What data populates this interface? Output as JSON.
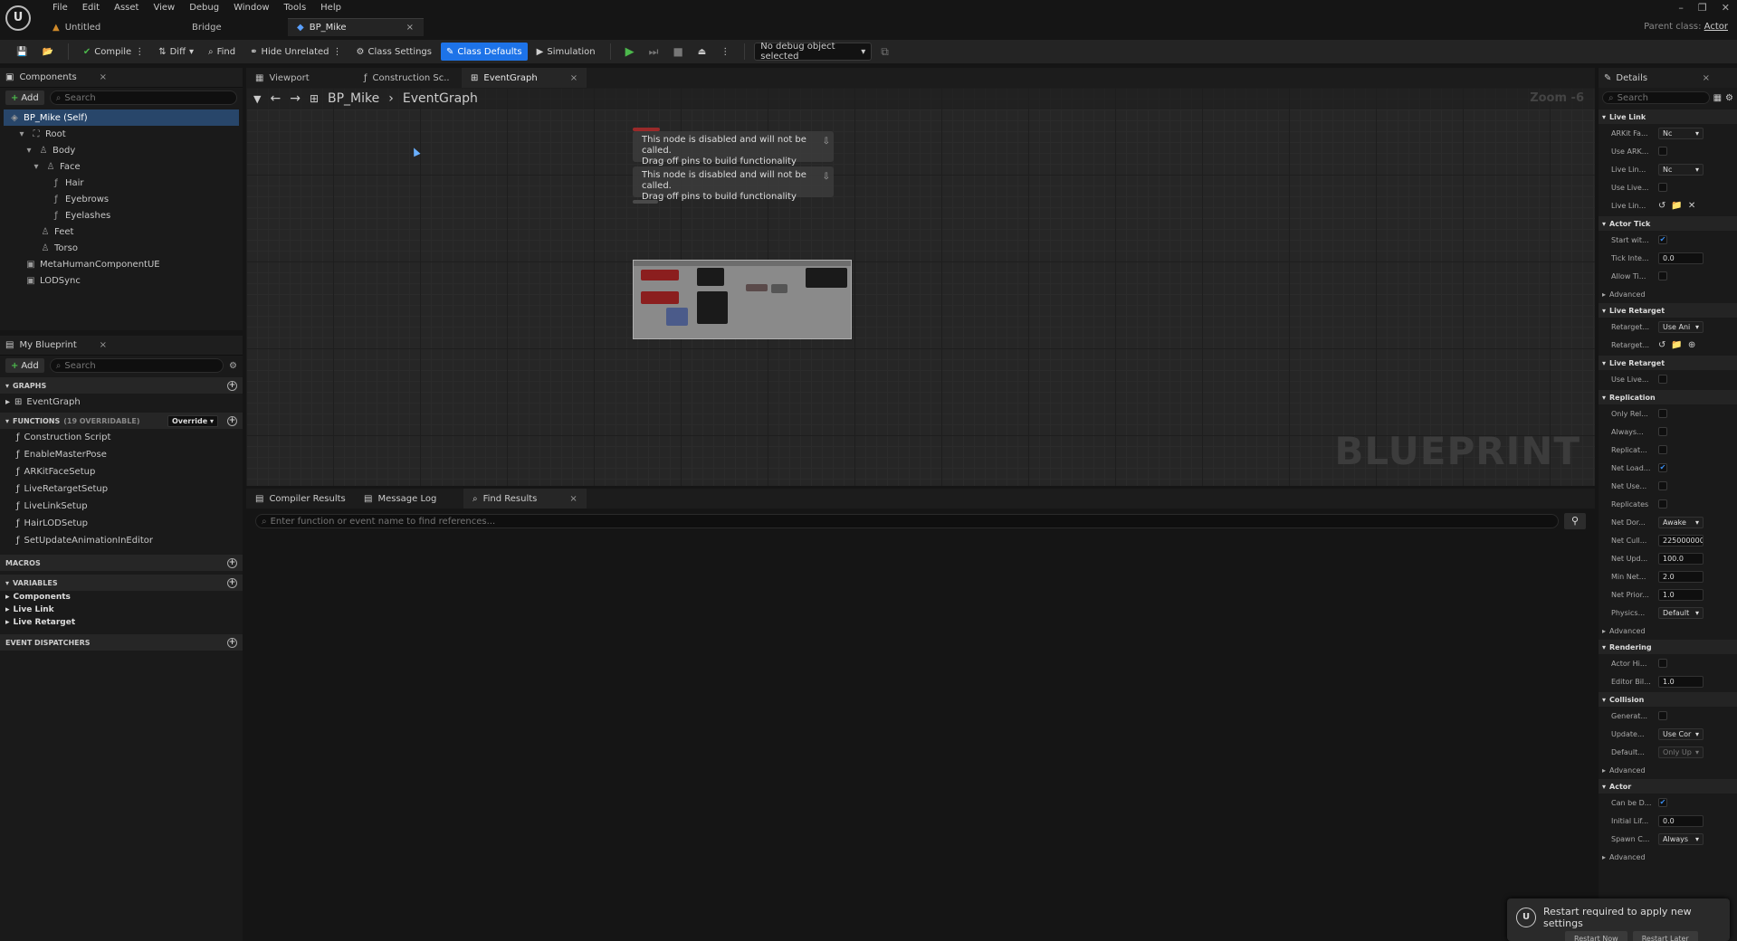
{
  "menu": [
    "File",
    "Edit",
    "Asset",
    "View",
    "Debug",
    "Window",
    "Tools",
    "Help"
  ],
  "doc_tabs": [
    {
      "label": "Untitled",
      "active": false
    },
    {
      "label": "Bridge",
      "active": false
    },
    {
      "label": "BP_Mike",
      "active": true
    }
  ],
  "parent_class": {
    "label": "Parent class:",
    "value": "Actor"
  },
  "toolbar": {
    "compile": "Compile",
    "diff": "Diff",
    "find": "Find",
    "hide_unrelated": "Hide Unrelated",
    "class_settings": "Class Settings",
    "class_defaults": "Class Defaults",
    "simulation": "Simulation",
    "debug_object": "No debug object selected"
  },
  "components": {
    "tab": "Components",
    "add": "Add",
    "search_placeholder": "Search",
    "items": [
      "BP_Mike (Self)",
      "Root",
      "Body",
      "Face",
      "Hair",
      "Eyebrows",
      "Eyelashes",
      "Feet",
      "Torso",
      "MetaHumanComponentUE",
      "LODSync"
    ]
  },
  "my_blueprint": {
    "tab": "My Blueprint",
    "add": "Add",
    "search_placeholder": "Search",
    "graphs_head": "GRAPHS",
    "graphs": [
      "EventGraph"
    ],
    "functions_head": "FUNCTIONS",
    "functions_count": "(19 OVERRIDABLE)",
    "override": "Override",
    "functions": [
      "Construction Script",
      "EnableMasterPose",
      "ARKitFaceSetup",
      "LiveRetargetSetup",
      "LiveLinkSetup",
      "HairLODSetup",
      "SetUpdateAnimationInEditor"
    ],
    "macros_head": "MACROS",
    "variables_head": "VARIABLES",
    "variables": [
      "Components",
      "Live Link",
      "Live Retarget"
    ],
    "dispatchers_head": "EVENT DISPATCHERS"
  },
  "graph": {
    "tabs": [
      "Viewport",
      "Construction Sc..",
      "EventGraph"
    ],
    "breadcrumb_root": "BP_Mike",
    "breadcrumb_leaf": "EventGraph",
    "zoom": "Zoom -6",
    "watermark": "BLUEPRINT",
    "disabled_msg_1": "This node is disabled and will not be called.",
    "disabled_msg_2": "Drag off pins to build functionality"
  },
  "bottom": {
    "tabs": [
      "Compiler Results",
      "Message Log",
      "Find Results"
    ],
    "find_placeholder": "Enter function or event name to find references..."
  },
  "details": {
    "tab": "Details",
    "search_placeholder": "Search",
    "live_link": "Live Link",
    "actor_tick": "Actor Tick",
    "advanced": "Advanced",
    "live_retarget": "Live Retarget",
    "replication": "Replication",
    "rendering": "Rendering",
    "collision": "Collision",
    "actor": "Actor",
    "props": {
      "arkit_fa": "ARKit Fa...",
      "arkit_fa_val": "Nc",
      "use_ark": "Use ARK...",
      "live_lin1": "Live Lin...",
      "live_lin1_val": "Nc",
      "use_live1": "Use Live...",
      "live_lin2": "Live Lin...",
      "start_wit": "Start wit...",
      "tick_inte": "Tick Inte...",
      "tick_inte_val": "0.0",
      "allow_ti": "Allow Ti...",
      "retarget1": "Retarget...",
      "retarget1_val": "Use Ani",
      "retarget2": "Retarget...",
      "use_live2": "Use Live...",
      "only_rel": "Only Rel...",
      "always": "Always...",
      "replicat": "Replicat...",
      "net_load": "Net Load...",
      "net_use": "Net Use...",
      "replicates": "Replicates",
      "net_dor": "Net Dor...",
      "net_dor_val": "Awake",
      "net_cull": "Net Cull...",
      "net_cull_val": "225000000",
      "net_upd": "Net Upd...",
      "net_upd_val": "100.0",
      "min_net": "Min Net...",
      "min_net_val": "2.0",
      "net_prior": "Net Prior...",
      "net_prior_val": "1.0",
      "physics": "Physics...",
      "physics_val": "Default",
      "actor_hi": "Actor Hi...",
      "editor_bil": "Editor Bil...",
      "editor_bil_val": "1.0",
      "generat": "Generat...",
      "update": "Update...",
      "update_val": "Use Cor",
      "default": "Default...",
      "default_val": "Only Up",
      "can_be_d": "Can be D...",
      "initial_lif": "Initial Lif...",
      "initial_lif_val": "0.0",
      "spawn_c": "Spawn C...",
      "spawn_c_val": "Always"
    }
  },
  "toast": {
    "message": "Restart required to apply new settings",
    "btn1": "Restart Now",
    "btn2": "Restart Later"
  }
}
